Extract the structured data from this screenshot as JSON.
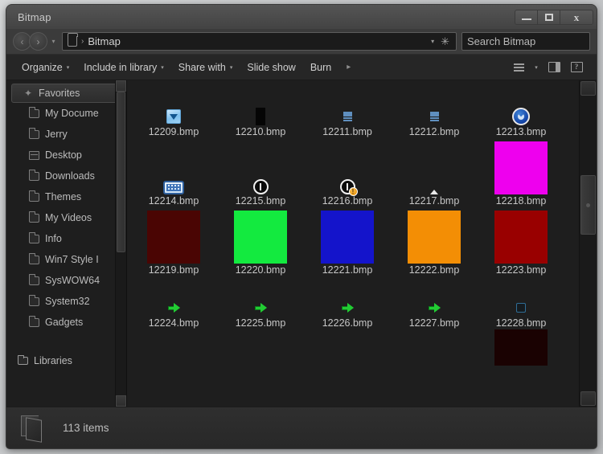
{
  "window": {
    "title": "Bitmap",
    "controls": {
      "minimize": "minimize-button",
      "maximize": "maximize-button",
      "close": "close-button"
    }
  },
  "address_bar": {
    "back": "‹",
    "forward": "›",
    "history_caret": "▾",
    "path_crumb": "Bitmap",
    "path_separator": "›",
    "path_dropdown_caret": "▾",
    "refresh_glyph": "✳",
    "search_placeholder": "Search Bitmap",
    "search_value": ""
  },
  "toolbar": {
    "items": [
      {
        "label": "Organize",
        "has_caret": true
      },
      {
        "label": "Include in library",
        "has_caret": true
      },
      {
        "label": "Share with",
        "has_caret": true
      },
      {
        "label": "Slide show",
        "has_caret": false
      },
      {
        "label": "Burn",
        "has_caret": false
      }
    ],
    "overflow_arrow": "▸",
    "caret": "▾",
    "right_icons": [
      "views-icon",
      "preview-pane-icon",
      "help-icon"
    ],
    "help_glyph": "?"
  },
  "sidebar": {
    "header": {
      "label": "Favorites",
      "icon": "star-icon",
      "glyph": "✦"
    },
    "items": [
      {
        "label": "My Docume",
        "icon": "folder-icon"
      },
      {
        "label": "Jerry",
        "icon": "folder-icon"
      },
      {
        "label": "Desktop",
        "icon": "desktop-icon"
      },
      {
        "label": "Downloads",
        "icon": "folder-icon"
      },
      {
        "label": "Themes",
        "icon": "folder-icon"
      },
      {
        "label": "My Videos",
        "icon": "folder-icon"
      },
      {
        "label": "Info",
        "icon": "folder-icon"
      },
      {
        "label": "Win7 Style I",
        "icon": "folder-icon"
      },
      {
        "label": "SysWOW64",
        "icon": "folder-icon"
      },
      {
        "label": "System32",
        "icon": "folder-icon"
      },
      {
        "label": "Gadgets",
        "icon": "folder-icon"
      }
    ],
    "libraries": {
      "label": "Libraries",
      "icon": "library-folder-icon"
    }
  },
  "files": [
    {
      "name": "12209.bmp",
      "thumb": "filter-icon",
      "kind": "icon"
    },
    {
      "name": "12210.bmp",
      "thumb": "black-rect-icon",
      "kind": "icon"
    },
    {
      "name": "12211.bmp",
      "thumb": "list-icon",
      "kind": "icon"
    },
    {
      "name": "12212.bmp",
      "thumb": "list-icon",
      "kind": "icon"
    },
    {
      "name": "12213.bmp",
      "thumb": "blue-clock-icon",
      "kind": "icon"
    },
    {
      "name": "12214.bmp",
      "thumb": "keyboard-icon",
      "kind": "icon"
    },
    {
      "name": "12215.bmp",
      "thumb": "power-icon",
      "kind": "icon"
    },
    {
      "name": "12216.bmp",
      "thumb": "power-warning-icon",
      "kind": "icon"
    },
    {
      "name": "12217.bmp",
      "thumb": "up-triangle-icon",
      "kind": "icon"
    },
    {
      "name": "12218.bmp",
      "thumb": "color-swatch",
      "kind": "swatch",
      "color": "#ee00ee"
    },
    {
      "name": "12219.bmp",
      "thumb": "color-swatch",
      "kind": "swatch",
      "color": "#4a0503"
    },
    {
      "name": "12220.bmp",
      "thumb": "color-swatch",
      "kind": "swatch",
      "color": "#13ea3f"
    },
    {
      "name": "12221.bmp",
      "thumb": "color-swatch",
      "kind": "swatch",
      "color": "#1414cb"
    },
    {
      "name": "12222.bmp",
      "thumb": "color-swatch",
      "kind": "swatch",
      "color": "#f38e05"
    },
    {
      "name": "12223.bmp",
      "thumb": "color-swatch",
      "kind": "swatch",
      "color": "#990000"
    },
    {
      "name": "12224.bmp",
      "thumb": "green-arrow-icon",
      "kind": "icon"
    },
    {
      "name": "12225.bmp",
      "thumb": "green-arrow-icon",
      "kind": "icon"
    },
    {
      "name": "12226.bmp",
      "thumb": "green-arrow-icon",
      "kind": "icon"
    },
    {
      "name": "12227.bmp",
      "thumb": "green-arrow-icon",
      "kind": "icon"
    },
    {
      "name": "12228.bmp",
      "thumb": "blue-box-icon",
      "kind": "icon"
    }
  ],
  "partial_thumb": {
    "color": "#1a0202"
  },
  "status": {
    "item_count": "113 items",
    "icon": "open-folder-icon"
  }
}
